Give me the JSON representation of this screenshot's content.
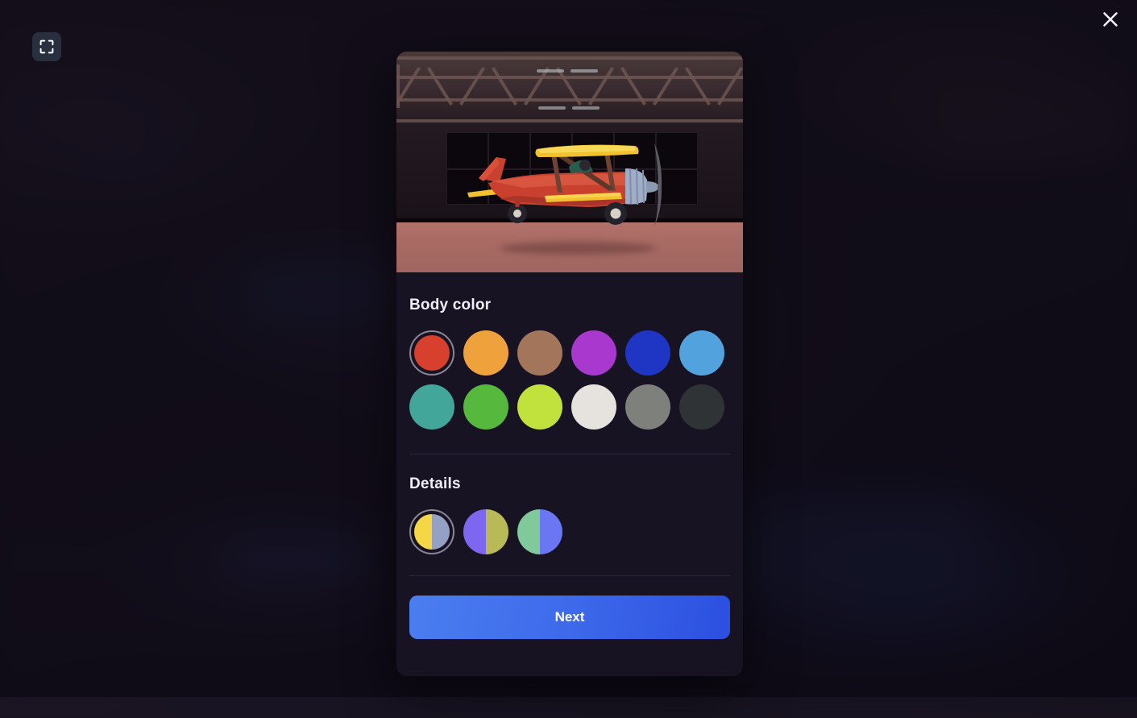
{
  "window": {
    "background_color": "#1a1520",
    "scrim_color": "rgba(10,7,16,0.62)"
  },
  "controls": {
    "fullscreen": {
      "icon": "fullscreen-expand-icon",
      "tooltip": "Fullscreen"
    },
    "close": {
      "icon": "close-icon",
      "label": "Close"
    }
  },
  "modal": {
    "preview": {
      "alt": "Red and yellow biplane parked inside a dark hangar",
      "scene": "hangar-interior",
      "aircraft": {
        "type": "biplane",
        "body_color": "#c9402f",
        "wing_color": "#f2c12e",
        "engine_color": "#9fadc6",
        "floor_color": "#ab6d66"
      }
    },
    "sections": [
      {
        "id": "body-color",
        "title": "Body color",
        "selected_index": 0,
        "swatches": [
          {
            "name": "red",
            "color": "#d6402c"
          },
          {
            "name": "orange",
            "color": "#efa23c"
          },
          {
            "name": "brown",
            "color": "#a3765c"
          },
          {
            "name": "purple",
            "color": "#a938cf"
          },
          {
            "name": "blue",
            "color": "#1f35c4"
          },
          {
            "name": "light-blue",
            "color": "#51a2dd"
          },
          {
            "name": "teal",
            "color": "#42a69b"
          },
          {
            "name": "green",
            "color": "#56b83c"
          },
          {
            "name": "lime",
            "color": "#c1e23c"
          },
          {
            "name": "white",
            "color": "#e6e2dd"
          },
          {
            "name": "gray",
            "color": "#7e807b"
          },
          {
            "name": "dark-gray",
            "color": "#2f3335"
          }
        ]
      },
      {
        "id": "details",
        "title": "Details",
        "selected_index": 0,
        "swatches": [
          {
            "name": "yellow-periwinkle",
            "color_left": "#f4d council",
            "left": "#f4d council"
          }
        ]
      }
    ],
    "details_swatches": [
      {
        "name": "yellow-steel",
        "left": "#f5d746",
        "right": "#94a0c4"
      },
      {
        "name": "violet-olive",
        "left": "#7d67f0",
        "right": "#b8ba58"
      },
      {
        "name": "mint-periwinkle",
        "left": "#7fc99b",
        "right": "#6b76f2"
      }
    ],
    "footer": {
      "next_label": "Next",
      "next_gradient_start": "#4b7ef0",
      "next_gradient_end": "#2b4fe0"
    }
  }
}
